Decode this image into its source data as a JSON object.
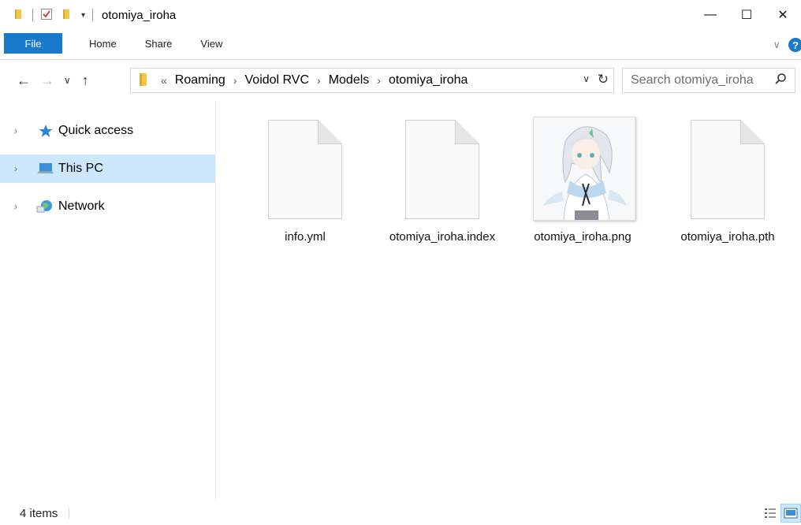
{
  "window": {
    "title": "otomiya_iroha",
    "controls": {
      "minimize": "—",
      "maximize": "☐",
      "close": "✕"
    }
  },
  "ribbon": {
    "tabs": [
      "File",
      "Home",
      "Share",
      "View"
    ],
    "expand_glyph": "∨",
    "help_glyph": "?"
  },
  "address": {
    "overflow": "«",
    "breadcrumbs": [
      "Roaming",
      "Voidol RVC",
      "Models",
      "otomiya_iroha"
    ],
    "separator": "›"
  },
  "search": {
    "placeholder": "Search otomiya_iroha"
  },
  "navpane": {
    "items": [
      {
        "label": "Quick access",
        "icon": "star-icon",
        "selected": false
      },
      {
        "label": "This PC",
        "icon": "computer-icon",
        "selected": true
      },
      {
        "label": "Network",
        "icon": "network-icon",
        "selected": false
      }
    ]
  },
  "files": [
    {
      "name": "info.yml",
      "type": "document"
    },
    {
      "name": "otomiya_iroha.index",
      "type": "document"
    },
    {
      "name": "otomiya_iroha.png",
      "type": "image"
    },
    {
      "name": "otomiya_iroha.pth",
      "type": "document"
    }
  ],
  "status": {
    "item_count": "4 items"
  },
  "colors": {
    "accent": "#1979ca",
    "selection": "#cce8ff",
    "folder": "#f3c64a"
  }
}
